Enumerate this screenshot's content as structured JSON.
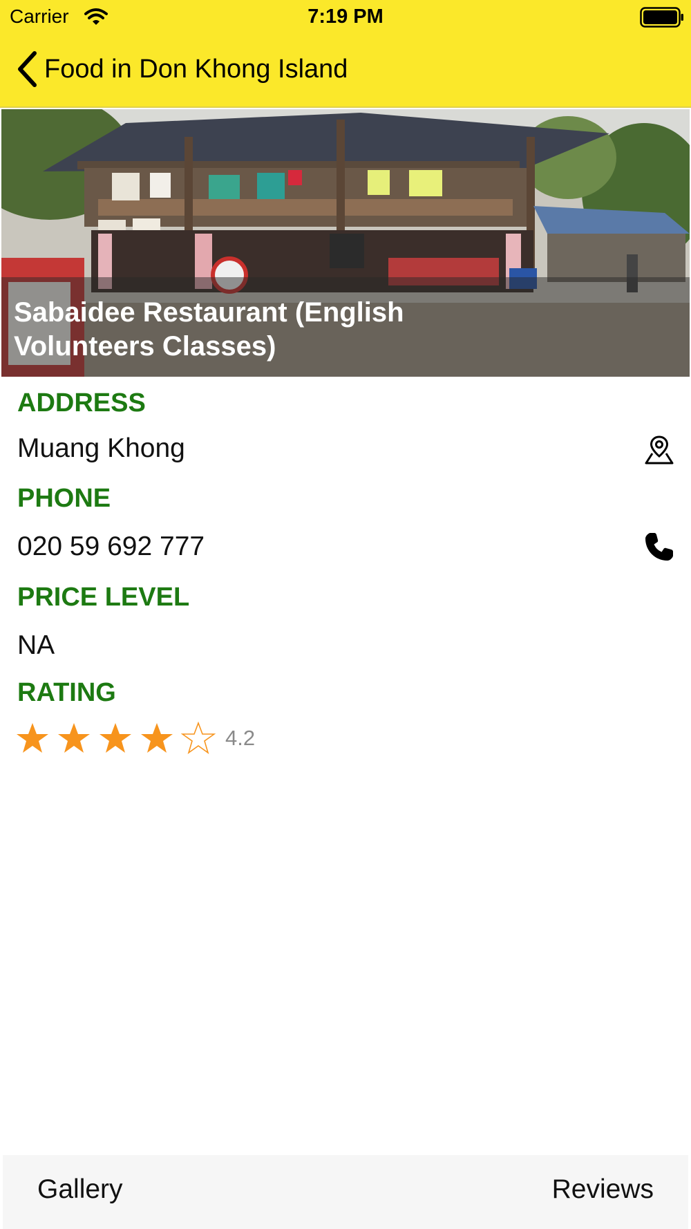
{
  "status_bar": {
    "carrier": "Carrier",
    "time": "7:19 PM",
    "icons": [
      "wifi-icon",
      "battery-icon"
    ]
  },
  "nav": {
    "back_icon": "chevron-left-icon",
    "title": "Food in Don Khong Island"
  },
  "place": {
    "name": "Sabaidee Restaurant (English Volunteers Classes)",
    "address_label": "ADDRESS",
    "address": "Muang Khong",
    "address_action_icon": "map-pin-icon",
    "phone_label": "PHONE",
    "phone": "020 59 692 777",
    "phone_action_icon": "phone-icon",
    "price_label": "PRICE LEVEL",
    "price": "NA",
    "rating_label": "RATING",
    "rating": 4.2,
    "rating_text": "4.2",
    "stars_total": 5
  },
  "tabs": {
    "gallery": "Gallery",
    "reviews": "Reviews"
  },
  "colors": {
    "header_bg": "#fbe82a",
    "label_green": "#1d7a12",
    "star_orange": "#f7941d",
    "tab_bar_bg": "#f6f6f6"
  }
}
